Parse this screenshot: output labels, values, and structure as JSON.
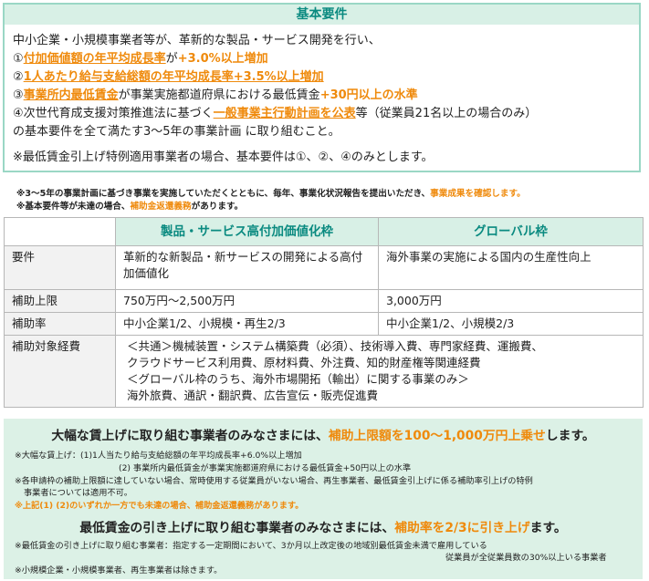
{
  "basic": {
    "title": "基本要件",
    "line1": "中小企業・小規模事業者等が、革新的な製品・サービス開発を行い、",
    "l2_pre": "①",
    "l2_em": "付加価値額の年平均成長率",
    "l2_mid": "が",
    "l2_post": "+3.0%以上増加",
    "l3_pre": "②",
    "l3_em": "1人あたり給与支給総額の年平均成長率+3.5%以上増加",
    "l4_pre": "③",
    "l4_em": "事業所内最低賃金",
    "l4_mid": "が事業実施都道府県における最低賃金",
    "l4_post": "+30円以上の水準",
    "l5_pre": "④次世代育成支援対策推進法に基づく",
    "l5_em": "一般事業主行動計画を公表",
    "l5_post": "等（従業員21名以上の場合のみ）",
    "line6": "の基本要件を全て満たす3～5年の事業計画 に取り組むこと。",
    "line7": "※最低賃金引上げ特例適用事業者の場合、基本要件は①、②、④のみとします。"
  },
  "notes": {
    "n1_pre": "※3～5年の事業計画に基づき事業を実施していただくとともに、毎年、事業化状況報告を提出いただき、",
    "n1_em": "事業成果を確認します。",
    "n2_pre": "※基本要件等が未達の場合、",
    "n2_em": "補助金返還義務",
    "n2_post": "があります。"
  },
  "table": {
    "col1": "製品・サービス高付加価値化枠",
    "col2": "グローバル枠",
    "rows": [
      {
        "label": "要件",
        "c1": "革新的な新製品・新サービスの開発による高付加価値化",
        "c2": "海外事業の実施による国内の生産性向上"
      },
      {
        "label": "補助上限",
        "c1": "750万円～2,500万円",
        "c2": "3,000万円"
      },
      {
        "label": "補助率",
        "c1": "中小企業1/2、小規模・再生2/3",
        "c2": "中小企業1/2、小規模2/3"
      }
    ],
    "expense_label": "補助対象経費",
    "expense_l1": "＜共通＞機械装置・システム構築費（必須）、技術導入費、専門家経費、運搬費、",
    "expense_l2": "クラウドサービス利用費、原材料費、外注費、知的財産権等関連経費",
    "expense_l3": "＜グローバル枠のうち、海外市場開拓（輸出）に関する事業のみ＞",
    "expense_l4": "海外旅費、通訳・翻訳費、広告宣伝・販売促進費"
  },
  "bottom": {
    "h1_pre": "大幅な賃上げに取り組む事業者のみなさまには、",
    "h1_em": "補助上限額を100～1,000万円上乗せ",
    "h1_post": "します。",
    "a1": "※大幅な賃上げ：(1)1人当たり給与支給総額の年平均成長率+6.0%以上増加",
    "a2": "(2) 事業所内最低賃金が事業実施都道府県における最低賃金+50円以上の水準",
    "a3": "※各申請枠の補助上限額に達していない場合、常時使用する従業員がいない場合、再生事業者、最低賃金引上げに係る補助率引上げの特例",
    "a4": "事業者については適用不可。",
    "a5": "※上記(1) (2)のいずれか一方でも未達の場合、補助金返還義務があります。",
    "h2_pre": "最低賃金の引き上げに取り組む事業者のみなさまには、",
    "h2_em": "補助率を2/3に引き上げ",
    "h2_post": "ます。",
    "b1": "※最低賃金の引き上げに取り組む事業者：指定する一定期間において、3か月以上改定後の地域別最低賃金未満で雇用している",
    "b2": "従業員が全従業員数の30%以上いる事業者",
    "b3": "※小規模企業・小規模事業者、再生事業者は除きます。"
  }
}
